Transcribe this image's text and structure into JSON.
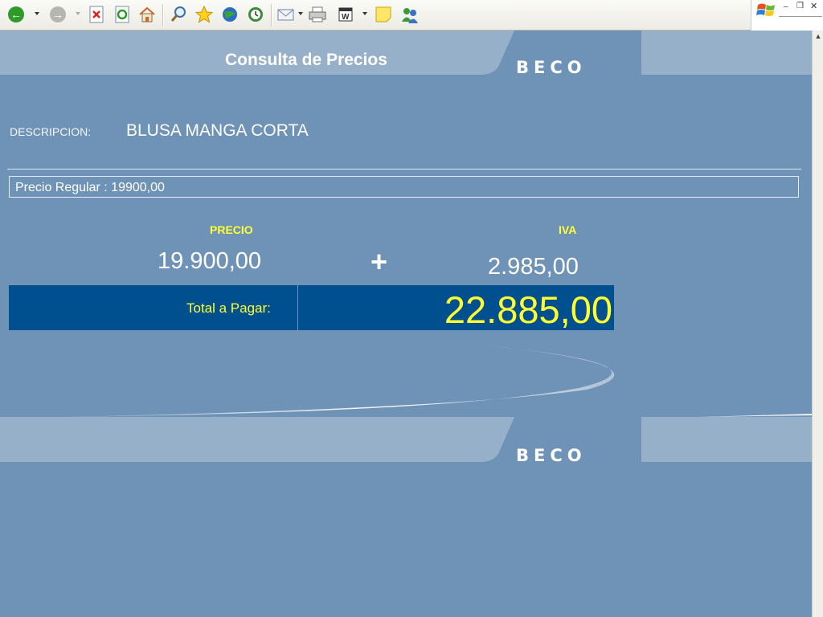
{
  "header": {
    "title": "Consulta de Precios",
    "brand": "BECO"
  },
  "footer": {
    "brand": "BECO"
  },
  "product": {
    "description_label": "DESCRIPCION:",
    "description": "BLUSA MANGA CORTA",
    "regular_price": "Precio Regular : 19900,00"
  },
  "pricing": {
    "price_label": "PRECIO",
    "price_value": "19.900,00",
    "plus": "+",
    "tax_label": "IVA",
    "tax_value": "2.985,00",
    "total_label": "Total a Pagar:",
    "total_value": "22.885,00"
  },
  "toolbar": {
    "icons": [
      "back-icon",
      "forward-icon",
      "stop-icon",
      "refresh-icon",
      "home-icon",
      "search-icon",
      "favorites-icon",
      "media-icon",
      "history-icon",
      "mail-icon",
      "print-icon",
      "edit-icon",
      "note-icon",
      "messenger-icon"
    ]
  },
  "colors": {
    "background": "#6f93b7",
    "band": "#97b0c9",
    "total_bg": "#00508f",
    "accent_yellow": "#ffff33"
  }
}
